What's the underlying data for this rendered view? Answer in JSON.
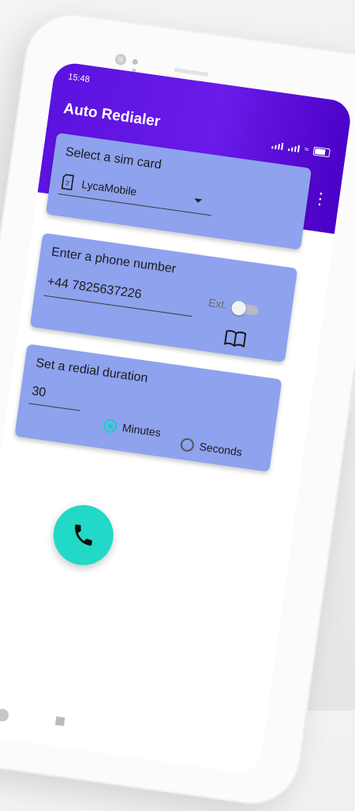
{
  "statusbar": {
    "time": "15:48"
  },
  "appbar": {
    "title": "Auto Redialer",
    "menu_icon": "more-vert-icon"
  },
  "sim": {
    "label": "Select a sim card",
    "value": "LycaMobile",
    "icon": "sim-card-icon"
  },
  "phone": {
    "label": "Enter a phone number",
    "value": "+44 7825637226",
    "ext_label": "Ext.",
    "ext_enabled": false,
    "contacts_icon": "book-icon"
  },
  "duration": {
    "label": "Set a redial duration",
    "value": "30",
    "options": [
      {
        "label": "Minutes",
        "selected": true
      },
      {
        "label": "Seconds",
        "selected": false
      }
    ]
  },
  "fab": {
    "icon": "phone-icon"
  },
  "colors": {
    "appbar": "#5b12e0",
    "card": "#8ea2ee",
    "accent": "#22d8c6"
  }
}
